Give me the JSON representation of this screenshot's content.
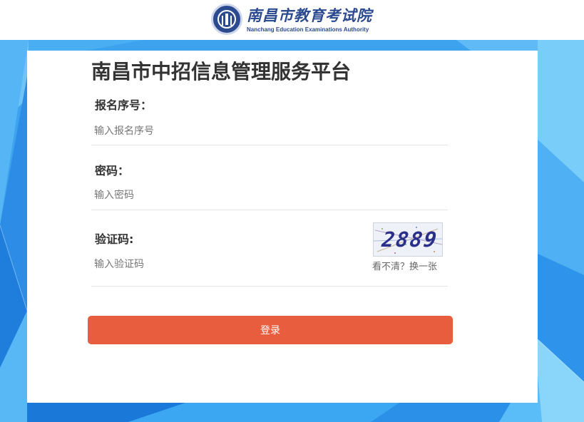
{
  "header": {
    "logo_cn": "南昌市教育考试院",
    "logo_en": "Nanchang Education Examinations Authority"
  },
  "form": {
    "title": "南昌市中招信息管理服务平台",
    "reg_label": "报名序号：",
    "reg_placeholder": "输入报名序号",
    "reg_value": "",
    "pwd_label": "密码：",
    "pwd_placeholder": "输入密码",
    "pwd_value": "",
    "captcha_label": "验证码:",
    "captcha_placeholder": "输入验证码",
    "captcha_value": "",
    "captcha_code": "2889",
    "refresh_text": "看不清？换一张",
    "login_label": "登录"
  },
  "colors": {
    "brand": "#2c4a8f",
    "button": "#e85d3e",
    "background": "#3fa6f0"
  }
}
